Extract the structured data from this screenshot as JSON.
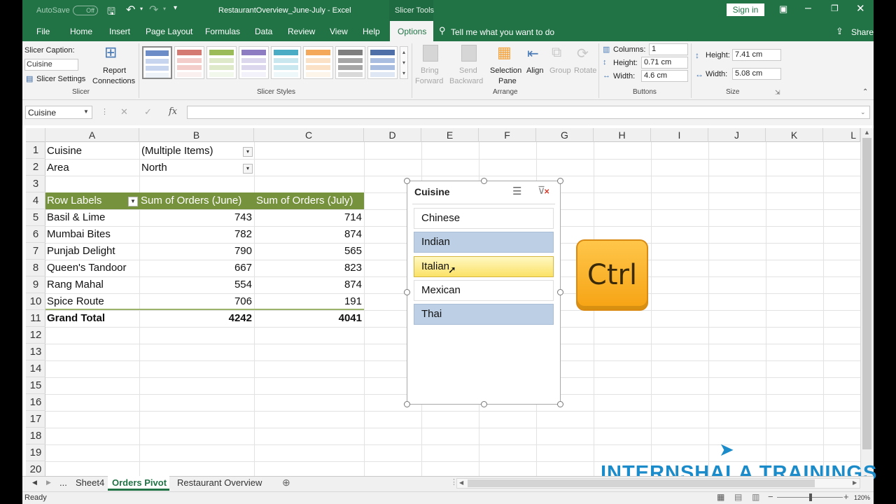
{
  "titlebar": {
    "autosave": "AutoSave",
    "autosave_state": "Off",
    "doc_title": "RestaurantOverview_June-July  -  Excel",
    "context_label": "Slicer Tools",
    "signin": "Sign in"
  },
  "tabs": [
    "File",
    "Home",
    "Insert",
    "Page Layout",
    "Formulas",
    "Data",
    "Review",
    "View",
    "Help",
    "Options"
  ],
  "tell_me": "Tell me what you want to do",
  "share": "Share",
  "ribbon": {
    "slicer_caption_label": "Slicer Caption:",
    "slicer_caption_value": "Cuisine",
    "slicer_settings": "Slicer Settings",
    "report_connections_1": "Report",
    "report_connections_2": "Connections",
    "group_slicer": "Slicer",
    "group_styles": "Slicer Styles",
    "bring_forward_1": "Bring",
    "bring_forward_2": "Forward",
    "send_backward_1": "Send",
    "send_backward_2": "Backward",
    "selection_pane_1": "Selection",
    "selection_pane_2": "Pane",
    "align": "Align",
    "group": "Group",
    "rotate": "Rotate",
    "group_arrange": "Arrange",
    "columns_label": "Columns:",
    "columns_value": "1",
    "btn_height_label": "Height:",
    "btn_height_value": "0.71 cm",
    "btn_width_label": "Width:",
    "btn_width_value": "4.6 cm",
    "group_buttons": "Buttons",
    "size_height_label": "Height:",
    "size_height_value": "7.41 cm",
    "size_width_label": "Width:",
    "size_width_value": "5.08 cm",
    "group_size": "Size"
  },
  "formula_bar": {
    "name_box": "Cuisine",
    "fx": "fx",
    "formula": ""
  },
  "columns": [
    "A",
    "B",
    "C",
    "D",
    "E",
    "F",
    "G",
    "H",
    "I",
    "J",
    "K",
    "L"
  ],
  "rows": [
    "1",
    "2",
    "3",
    "4",
    "5",
    "6",
    "7",
    "8",
    "9",
    "10",
    "11",
    "12",
    "13",
    "14",
    "15",
    "16",
    "17",
    "18",
    "19",
    "20"
  ],
  "pivot": {
    "filter1_label": "Cuisine",
    "filter1_value": "(Multiple Items)",
    "filter2_label": "Area",
    "filter2_value": "North",
    "header_row_labels": "Row Labels",
    "header_june": "Sum of Orders (June)",
    "header_july": "Sum of Orders (July)",
    "rows": [
      {
        "name": "Basil & Lime",
        "june": "743",
        "july": "714"
      },
      {
        "name": "Mumbai Bites",
        "june": "782",
        "july": "874"
      },
      {
        "name": "Punjab Delight",
        "june": "790",
        "july": "565"
      },
      {
        "name": "Queen's Tandoor",
        "june": "667",
        "july": "823"
      },
      {
        "name": "Rang Mahal",
        "june": "554",
        "july": "874"
      },
      {
        "name": "Spice Route",
        "june": "706",
        "july": "191"
      }
    ],
    "grand_total_label": "Grand Total",
    "grand_total_june": "4242",
    "grand_total_july": "4041"
  },
  "slicer": {
    "title": "Cuisine",
    "items": [
      {
        "label": "Chinese",
        "state": "unselected"
      },
      {
        "label": "Indian",
        "state": "selected"
      },
      {
        "label": "Italian",
        "state": "hover"
      },
      {
        "label": "Mexican",
        "state": "unselected"
      },
      {
        "label": "Thai",
        "state": "selected"
      }
    ]
  },
  "ctrl_key": "Ctrl",
  "sheet_tabs": [
    "...",
    "Sheet4",
    "Orders Pivot",
    "Restaurant Overview"
  ],
  "active_sheet": "Orders Pivot",
  "status": {
    "ready": "Ready",
    "zoom": "120%"
  },
  "watermark": "INTERNSHALA TRAININGS",
  "colors": {
    "excel_green": "#217346",
    "pivot_header": "#76923c",
    "slicer_selected": "#bdcfe4",
    "ctrl_key": "#f6a313"
  }
}
